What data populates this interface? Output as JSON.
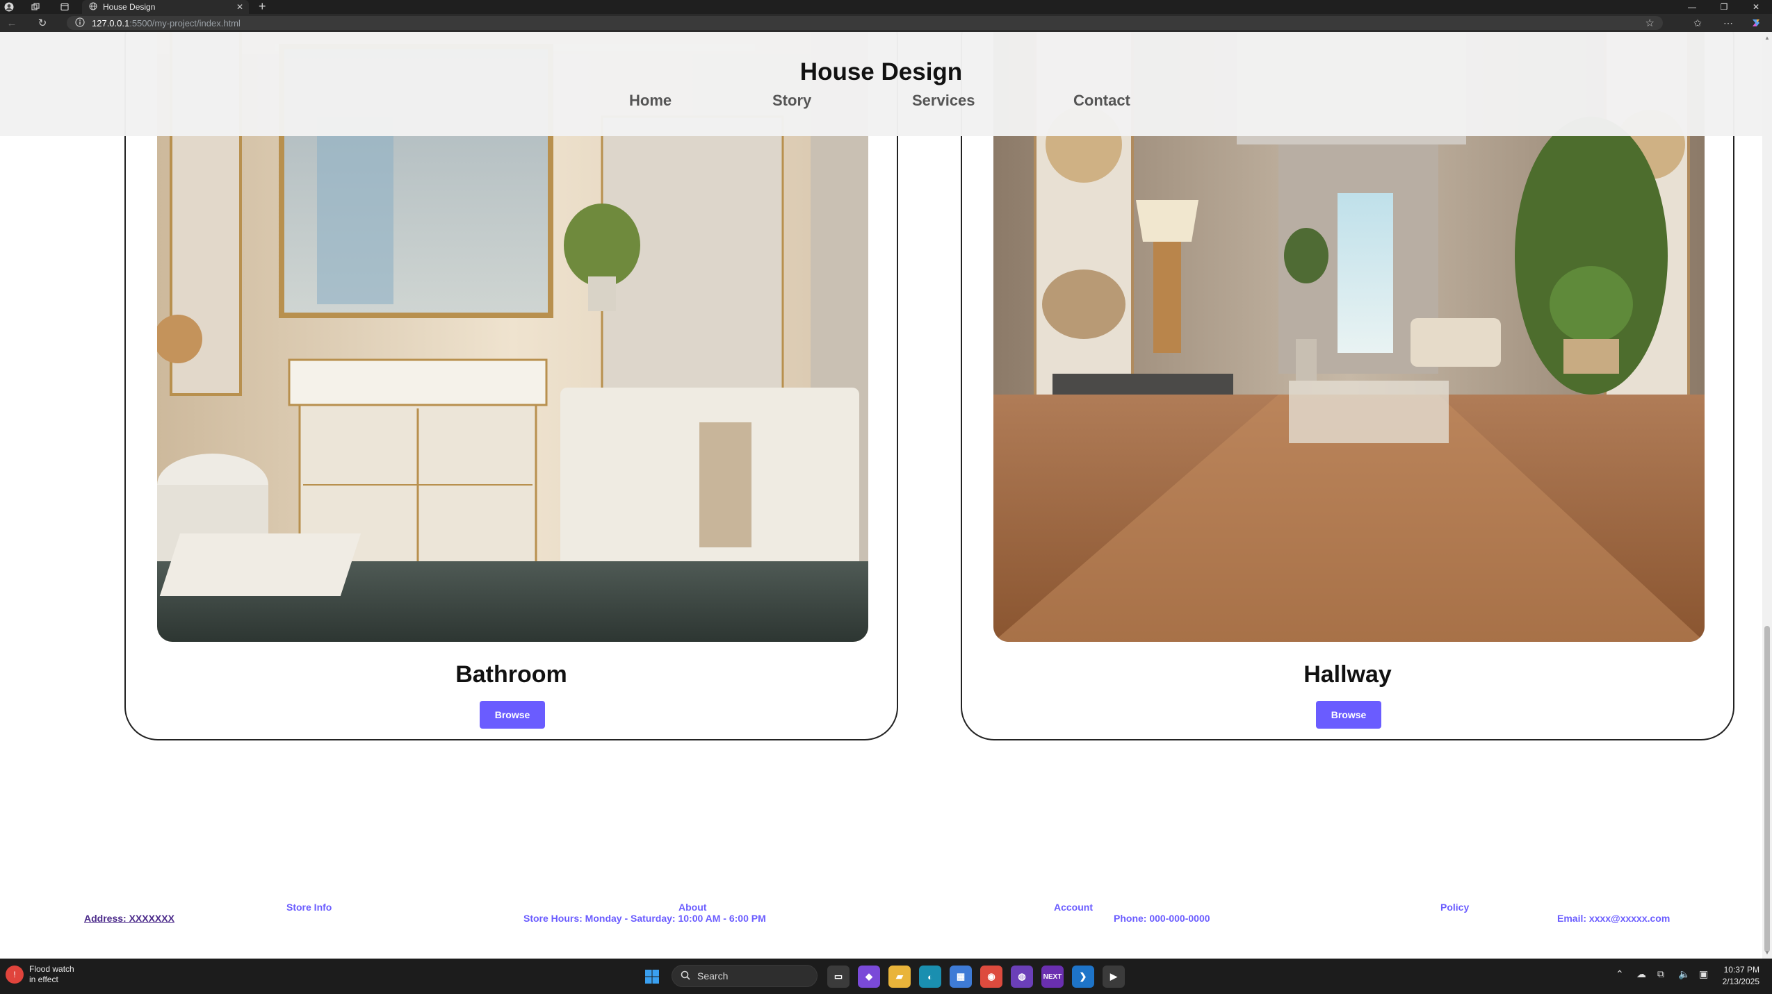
{
  "browser": {
    "tab_title": "House Design",
    "url_host": "127.0.0.1",
    "url_path": ":5500/my-project/index.html"
  },
  "header": {
    "title": "House Design",
    "nav": [
      "Home",
      "Story",
      "Services",
      "Contact"
    ]
  },
  "cards": [
    {
      "title": "Bathroom",
      "button": "Browse"
    },
    {
      "title": "Hallway",
      "button": "Browse"
    }
  ],
  "footer": {
    "address": "Address: XXXXXXX",
    "store_info": "Store Info",
    "about": "About",
    "hours": "Store Hours: Monday - Saturday: 10:00 AM - 6:00 PM",
    "account": "Account",
    "phone": "Phone: 000-000-0000",
    "policy": "Policy",
    "email": "Email: xxxx@xxxxx.com"
  },
  "taskbar": {
    "weather_line1": "Flood watch",
    "weather_line2": "in effect",
    "search_label": "Search",
    "time": "10:37 PM",
    "date": "2/13/2025",
    "next_label": "NEXT"
  },
  "colors": {
    "accent": "#6a5cff",
    "header_bg": "#f2f2f2",
    "chrome_bg": "#2b2b2b"
  },
  "icons": [
    "profile-icon",
    "workspaces-icon",
    "tab-actions-icon",
    "globe-icon",
    "close-icon",
    "plus-icon",
    "back-icon",
    "refresh-icon",
    "info-icon",
    "star-icon",
    "favorites-icon",
    "more-icon",
    "copilot-icon",
    "windows-icon",
    "search-icon"
  ]
}
